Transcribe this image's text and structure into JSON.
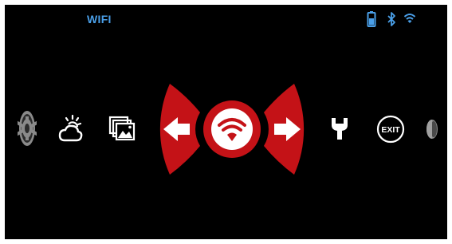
{
  "header": {
    "title": "WIFI"
  },
  "status_bar": {
    "icons": [
      "battery-icon",
      "bluetooth-icon",
      "wifi-status-icon"
    ]
  },
  "menu": {
    "items": [
      {
        "icon": "settings-gear-icon"
      },
      {
        "icon": "brightness-cloud-icon"
      },
      {
        "icon": "gallery-icon"
      },
      {
        "icon": "wifi-icon",
        "selected": true
      },
      {
        "icon": "wrench-icon"
      },
      {
        "icon": "exit-icon",
        "label": "EXIT"
      },
      {
        "icon": "half-moon-icon"
      }
    ],
    "nav": {
      "prev_icon": "arrow-left-icon",
      "next_icon": "arrow-right-icon"
    }
  },
  "colors": {
    "background": "#000000",
    "title": "#4a9fe8",
    "status": "#4a9fe8",
    "accent_red": "#c41217",
    "icon_white": "#ffffff",
    "icon_dim": "#8a8a8a"
  }
}
